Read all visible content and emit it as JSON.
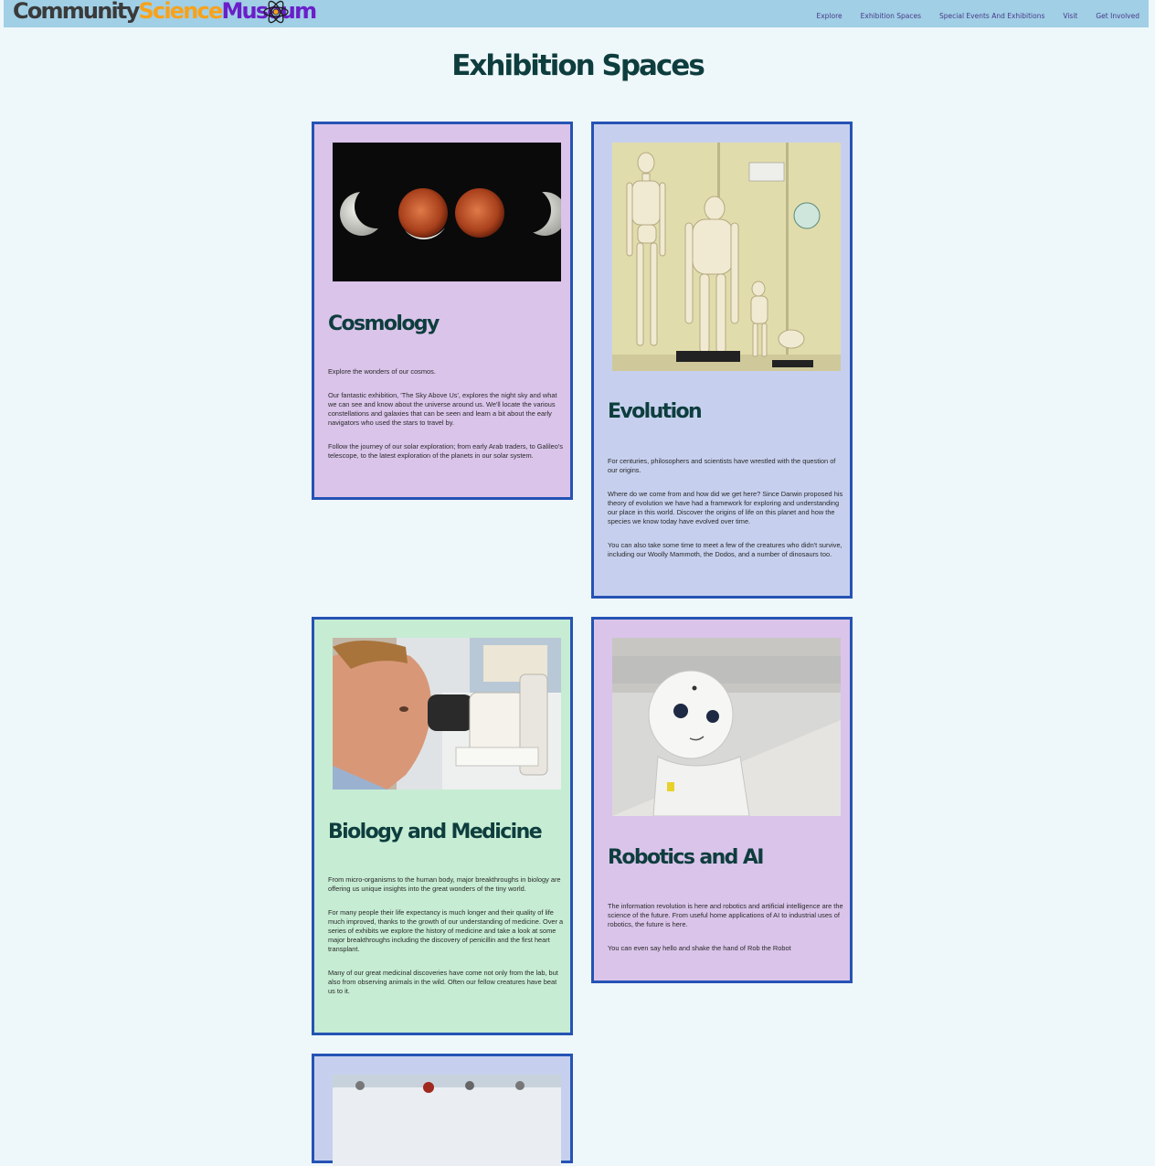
{
  "header": {
    "logo": {
      "part1": "Community",
      "part2": "Science",
      "part3": "Museum"
    },
    "logo_icon": "atom-icon",
    "nav": [
      "Explore",
      "Exhibition Spaces",
      "Special Events And Exhibitions",
      "Visit",
      "Get Involved"
    ]
  },
  "page_title": "Exhibition Spaces",
  "colors": {
    "nav_bg": "#a0cfe6",
    "page_bg": "#eef7fa",
    "card_border": "#2553b4",
    "card_purple": "#dac4ea",
    "card_blue": "#c6d0ee",
    "card_green": "#c6ecd3",
    "heading": "#0e3d3e"
  },
  "cards": [
    {
      "title": "Cosmology",
      "image": "lunar-eclipse-photo",
      "paragraphs": [
        "Explore the wonders of our cosmos.",
        "Our fantastic exhibition, 'The Sky Above Us', explores the night sky and what we can see and know about the universe around us. We'll locate the various constellations and galaxies that can be seen and learn a bit about the early navigators who used the stars to travel by.",
        "Follow the journey of our solar exploration; from early Arab traders, to Galileo's telescope, to the latest exploration of the planets in our solar system."
      ]
    },
    {
      "title": "Evolution",
      "image": "skeletons-display-photo",
      "paragraphs": [
        "For centuries, philosophers and scientists have wrestled with the question of our origins.",
        "Where do we come from and how did we get here? Since Darwin proposed his theory of evolution we have had a framework for exploring and understanding our place in this world. Discover the origins of life on this planet and how the species we know today have evolved over time.",
        "You can also take some time to meet a few of the creatures who didn't survive, including our Woolly Mammoth, the Dodos, and a number of dinosaurs too."
      ]
    },
    {
      "title": "Biology and Medicine",
      "image": "microscope-scientist-photo",
      "paragraphs": [
        "From micro-organisms to the human body, major breakthroughs in biology are offering us unique insights into the great wonders of the tiny world.",
        "For many people their life expectancy is much longer and their quality of life much improved, thanks to the growth of our understanding of medicine. Over a series of exhibits we explore the history of medicine and take a look at some major breakthroughs including the discovery of penicillin and the first heart transplant.",
        "Many of our great medicinal discoveries have come not only from the lab, but also from observing animals in the wild. Often our fellow creatures have beat us to it."
      ]
    },
    {
      "title": "Robotics and AI",
      "image": "white-robot-photo",
      "paragraphs": [
        "The information revolution is here and robotics and artificial intelligence are the science of the future. From useful home applications of AI to industrial uses of robotics, the future is here.",
        "You can even say hello and shake the hand of Rob the Robot"
      ]
    }
  ]
}
